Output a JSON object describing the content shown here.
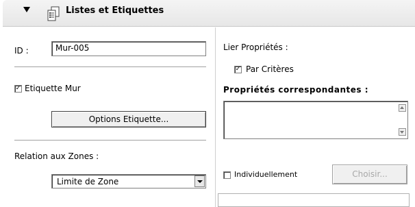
{
  "header": {
    "title": "Listes et Etiquettes",
    "icon": "list-document-icon"
  },
  "left": {
    "id_label": "ID :",
    "id_value": "Mur-005",
    "label_wall_checkbox": {
      "label": "Etiquette Mur",
      "checked": true,
      "mark": "✓"
    },
    "options_button": "Options Etiquette...",
    "zone_relation_label": "Relation aux Zones :",
    "zone_select": {
      "selected": "Limite de Zone"
    }
  },
  "right": {
    "link_properties_label": "Lier Propriétés :",
    "criteria_checkbox": {
      "label": "Par Critères",
      "checked": true,
      "mark": "✓"
    },
    "matching_properties_label": "Propriétés correspondantes :",
    "individually_checkbox": {
      "label": "Individuellement",
      "checked": false
    },
    "choose_button": "Choisir..."
  }
}
